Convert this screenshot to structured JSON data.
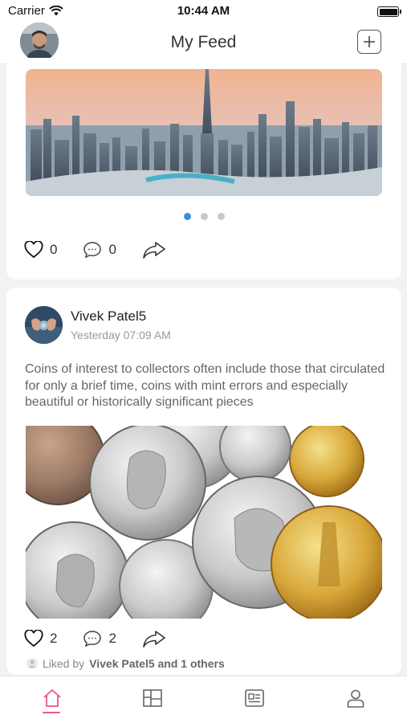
{
  "status_bar": {
    "carrier": "Carrier",
    "time": "10:44 AM"
  },
  "header": {
    "title": "My Feed"
  },
  "posts": [
    {
      "image": "city-skyline-photo",
      "carousel_dots": 3,
      "carousel_active": 1,
      "likes": "0",
      "comments": "0"
    },
    {
      "author": "Vivek Patel5",
      "time": "Yesterday 07:09 AM",
      "text": "Coins of interest to collectors often include those that circulated for only a brief time, coins with mint errors and especially beautiful or historically significant pieces",
      "image": "coins-photo",
      "likes": "2",
      "comments": "2",
      "liked_by_prefix": "Liked by",
      "liked_by_names": "Vivek Patel5 and 1 others"
    }
  ],
  "tabs": [
    {
      "name": "home-icon",
      "active": true
    },
    {
      "name": "grid-icon",
      "active": false
    },
    {
      "name": "news-icon",
      "active": false
    },
    {
      "name": "profile-icon",
      "active": false
    }
  ],
  "colors": {
    "accent": "#e75b83",
    "dot_active": "#3a8ee6"
  }
}
